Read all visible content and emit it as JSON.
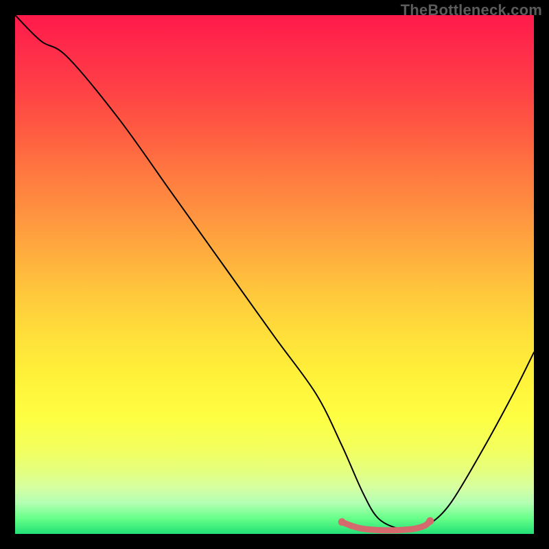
{
  "watermark": {
    "text": "TheBottleneck.com"
  },
  "chart_data": {
    "type": "line",
    "title": "",
    "xlabel": "",
    "ylabel": "",
    "xlim": [
      0,
      100
    ],
    "ylim": [
      0,
      100
    ],
    "series": [
      {
        "name": "curve",
        "x": [
          0,
          5,
          10,
          20,
          30,
          40,
          50,
          58,
          63,
          67,
          70,
          74,
          77,
          80,
          84,
          90,
          96,
          100
        ],
        "y": [
          100,
          95,
          92,
          80,
          66,
          52,
          38,
          27,
          17,
          8,
          3,
          1,
          1,
          2,
          6,
          16,
          27,
          35
        ]
      }
    ],
    "trough_marker": {
      "name": "trough",
      "color": "#d46a6e",
      "x": [
        63,
        65,
        67,
        69,
        71,
        73,
        75,
        77,
        79,
        80
      ],
      "y": [
        2.3,
        1.5,
        1.0,
        0.8,
        0.7,
        0.7,
        0.8,
        1.0,
        1.6,
        2.5
      ]
    }
  }
}
